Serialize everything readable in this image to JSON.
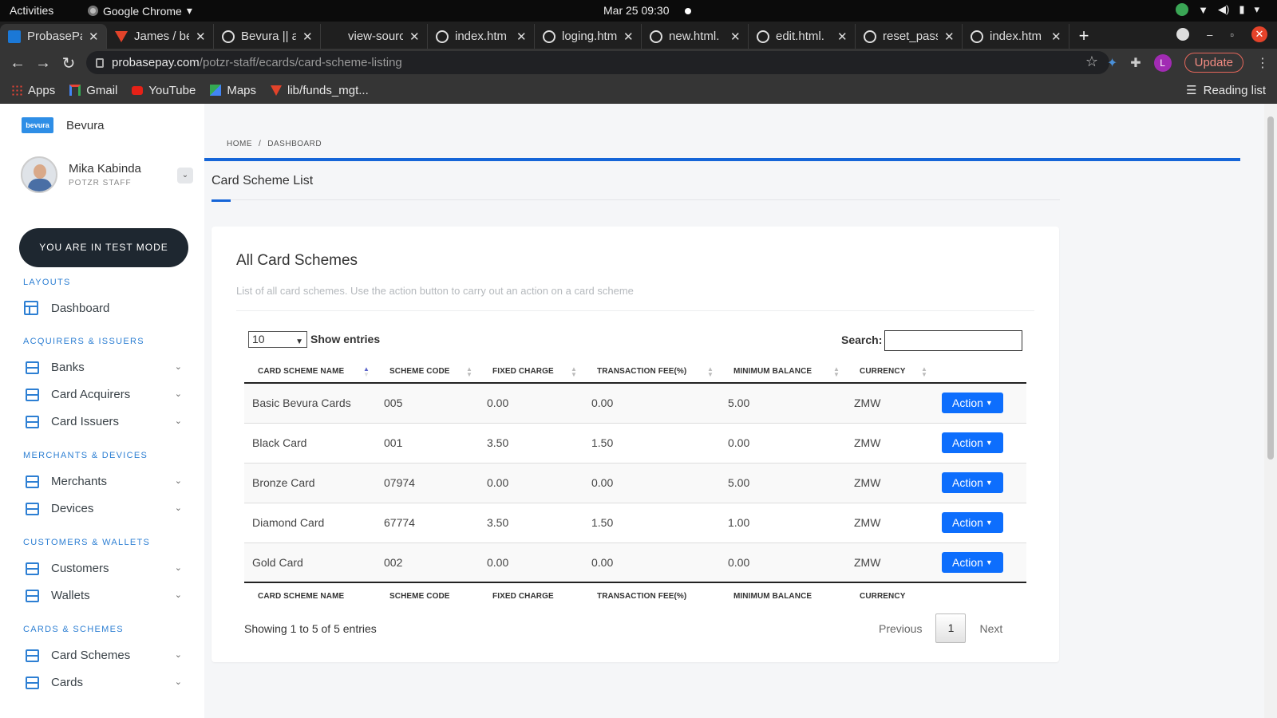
{
  "system": {
    "activities": "Activities",
    "app_name": "Google Chrome",
    "clock": "Mar 25  09:30"
  },
  "browser": {
    "tabs": [
      {
        "title": "ProbasePa",
        "icon": "bevura-favicon",
        "active": true
      },
      {
        "title": "James / be",
        "icon": "gitlab-icon"
      },
      {
        "title": "Bevura || a",
        "icon": "globe-icon"
      },
      {
        "title": "view-sourc",
        "icon": "none"
      },
      {
        "title": "index.htm",
        "icon": "globe-icon"
      },
      {
        "title": "loging.htm",
        "icon": "globe-icon"
      },
      {
        "title": "new.html.",
        "icon": "globe-icon"
      },
      {
        "title": "edit.html.",
        "icon": "globe-icon"
      },
      {
        "title": "reset_pass",
        "icon": "globe-icon"
      },
      {
        "title": "index.htm",
        "icon": "globe-icon"
      }
    ],
    "url_host": "probasepay.com",
    "url_path": "/potzr-staff/ecards/card-scheme-listing",
    "profile_initial": "L",
    "update_label": "Update",
    "bookmarks": [
      "Apps",
      "Gmail",
      "YouTube",
      "Maps",
      "lib/funds_mgt..."
    ],
    "reading_list": "Reading list"
  },
  "sidebar": {
    "brand": "Bevura",
    "logo_text": "bevura",
    "user_name": "Mika Kabinda",
    "user_role": "POTZR STAFF",
    "test_mode": "YOU ARE IN TEST MODE",
    "sections": [
      {
        "title": "LAYOUTS",
        "items": [
          "Dashboard"
        ]
      },
      {
        "title": "ACQUIRERS & ISSUERS",
        "items": [
          "Banks",
          "Card Acquirers",
          "Card Issuers"
        ]
      },
      {
        "title": "MERCHANTS & DEVICES",
        "items": [
          "Merchants",
          "Devices"
        ]
      },
      {
        "title": "CUSTOMERS & WALLETS",
        "items": [
          "Customers",
          "Wallets"
        ]
      },
      {
        "title": "CARDS & SCHEMES",
        "items": [
          "Card Schemes",
          "Cards"
        ]
      }
    ]
  },
  "breadcrumb": {
    "home": "HOME",
    "sep": "/",
    "current": "DASHBOARD"
  },
  "page_title": "Card Scheme List",
  "card": {
    "title": "All Card Schemes",
    "description": "List of all card schemes. Use the action button to carry out an action on a card scheme",
    "length_value": "10",
    "length_label": "Show entries",
    "search_label": "Search:",
    "search_value": ""
  },
  "table": {
    "columns": [
      "CARD SCHEME NAME",
      "SCHEME CODE",
      "FIXED CHARGE",
      "TRANSACTION FEE(%)",
      "MINIMUM BALANCE",
      "CURRENCY"
    ],
    "action_label": "Action",
    "rows": [
      [
        "Basic Bevura Cards",
        "005",
        "0.00",
        "0.00",
        "5.00",
        "ZMW"
      ],
      [
        "Black Card",
        "001",
        "3.50",
        "1.50",
        "0.00",
        "ZMW"
      ],
      [
        "Bronze Card",
        "07974",
        "0.00",
        "0.00",
        "5.00",
        "ZMW"
      ],
      [
        "Diamond Card",
        "67774",
        "3.50",
        "1.50",
        "1.00",
        "ZMW"
      ],
      [
        "Gold Card",
        "002",
        "0.00",
        "0.00",
        "0.00",
        "ZMW"
      ]
    ],
    "info": "Showing 1 to 5 of 5 entries",
    "previous": "Previous",
    "current_page": "1",
    "next": "Next"
  },
  "colors": {
    "accent": "#1565d8",
    "action_button": "#0d6efd",
    "section_title": "#2d7fd3",
    "test_mode_bg": "#1e2730"
  }
}
